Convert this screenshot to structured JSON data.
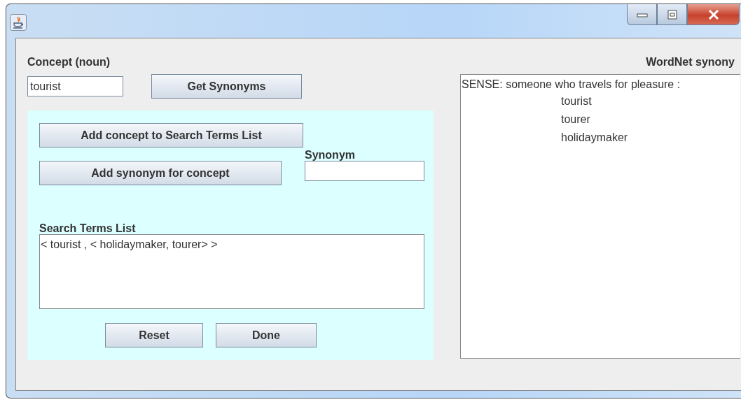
{
  "concept": {
    "label": "Concept (noun)",
    "value": "tourist"
  },
  "buttons": {
    "get_synonyms": "Get Synonyms",
    "add_concept": "Add concept to Search Terms List",
    "add_synonym": "Add synonym for concept",
    "reset": "Reset",
    "done": "Done"
  },
  "synonym": {
    "label": "Synonym"
  },
  "search_terms": {
    "label": "Search Terms List",
    "text": "< tourist , < holidaymaker, tourer> >"
  },
  "wordnet": {
    "label": "WordNet synony",
    "sense": "SENSE: someone who travels for pleasure :",
    "synonyms": [
      "tourist",
      "tourer",
      "holidaymaker"
    ]
  }
}
